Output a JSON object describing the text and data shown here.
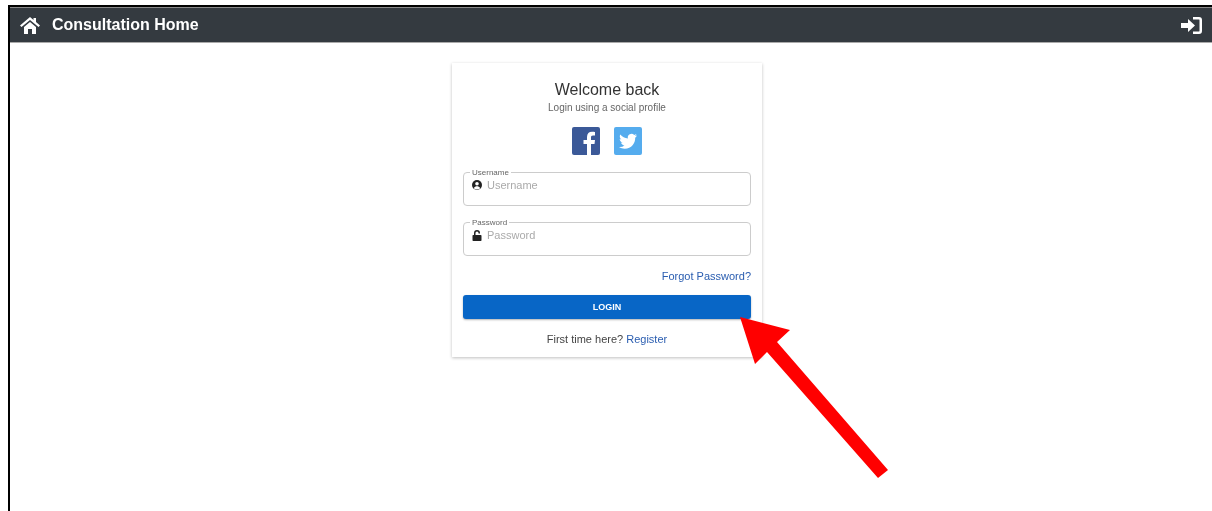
{
  "header": {
    "title": "Consultation Home"
  },
  "login_card": {
    "title": "Welcome back",
    "subtitle": "Login using a social profile",
    "social": [
      {
        "kind": "facebook"
      },
      {
        "kind": "twitter"
      }
    ],
    "fields": [
      {
        "kind": "user",
        "label": "Username",
        "placeholder": "Username"
      },
      {
        "kind": "lock",
        "label": "Password",
        "placeholder": "Password"
      }
    ],
    "forgot_link": "Forgot Password?",
    "login_button": "LOGIN",
    "register_prompt": "First time here?",
    "register_link": "Register"
  }
}
